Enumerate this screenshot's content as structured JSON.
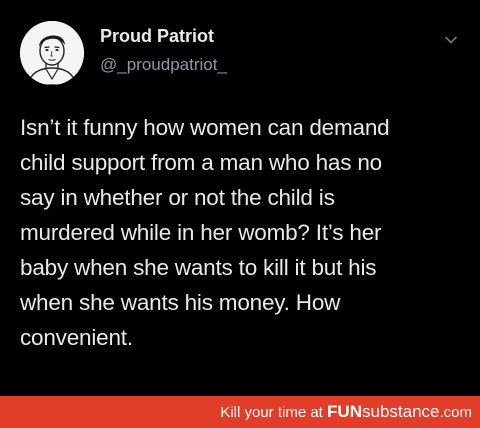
{
  "tweet": {
    "display_name": "Proud Patriot",
    "handle": "@_proudpatriot_",
    "more_icon": "chevron-down-icon",
    "avatar_icon": "avatar-portrait",
    "text_lines": [
      "Isn’t it funny how women can demand",
      "child support from a man who has no",
      "say in whether or not the child is",
      "murdered while in her womb? It’s her",
      "baby when she wants to kill it but his",
      "when she wants his money. How",
      "convenient."
    ]
  },
  "footer": {
    "tagline": "Kill your time at",
    "brand_bold": "FUN",
    "brand_rest": "substance",
    "brand_tld": ".com"
  },
  "colors": {
    "background": "#000000",
    "text": "#e9e9e9",
    "handle": "#8b98a5",
    "footer_bar": "#e23d28"
  }
}
